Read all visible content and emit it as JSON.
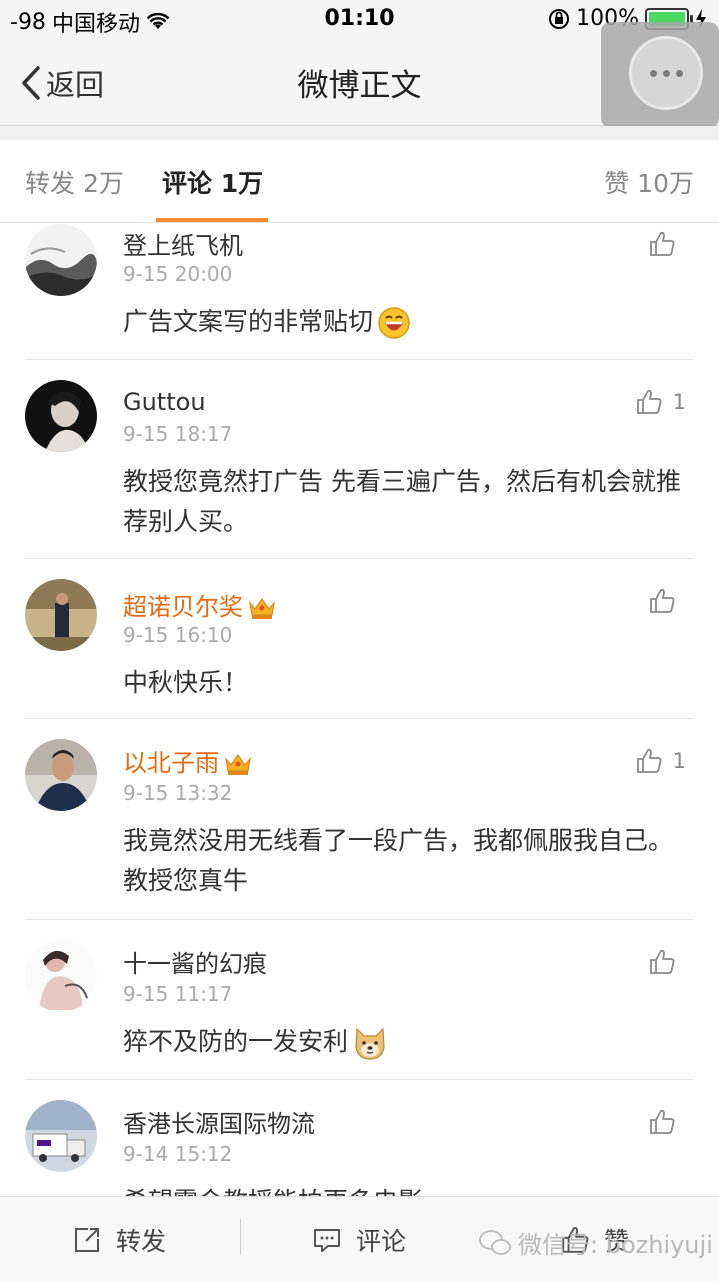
{
  "status_bar": {
    "signal": "-98",
    "carrier": "中国移动",
    "time": "01:10",
    "battery": "100%",
    "battery_level": 1.0
  },
  "nav": {
    "back_label": "返回",
    "title": "微博正文"
  },
  "tabs": {
    "repost": "转发 2万",
    "comments": "评论 1万",
    "likes": "赞 10万"
  },
  "comments": [
    {
      "name": "登上纸飞机",
      "time": "9-15 20:00",
      "text": "广告文案写的非常贴切",
      "likes": "",
      "vip": false,
      "emoji": "laughing-emoji"
    },
    {
      "name": "Guttou",
      "time": "9-15 18:17",
      "text": "教授您竟然打广告 先看三遍广告，然后有机会就推荐别人买。",
      "likes": "1",
      "vip": false,
      "emoji": ""
    },
    {
      "name": "超诺贝尔奖",
      "time": "9-15 16:10",
      "text": "中秋快乐！",
      "likes": "",
      "vip": true,
      "emoji": ""
    },
    {
      "name": "以北子雨",
      "time": "9-15 13:32",
      "text": "我竟然没用无线看了一段广告，我都佩服我自己。教授您真牛",
      "likes": "1",
      "vip": true,
      "emoji": ""
    },
    {
      "name": "十一酱的幻痕",
      "time": "9-15 11:17",
      "text": "猝不及防的一发安利",
      "likes": "",
      "vip": false,
      "emoji": "doge-emoji"
    },
    {
      "name": "香港长源国际物流",
      "time": "9-14 15:12",
      "text": "希望霍金教授能拍更多电影",
      "likes": "",
      "vip": false,
      "emoji": ""
    }
  ],
  "bottom_bar": {
    "repost": "转发",
    "comment": "评论",
    "like": "赞"
  },
  "watermark": "微信号: bozhiyuji",
  "colors": {
    "accent": "#f78c2c",
    "vip_name": "#e86a0f",
    "muted": "#aaaaaa"
  }
}
